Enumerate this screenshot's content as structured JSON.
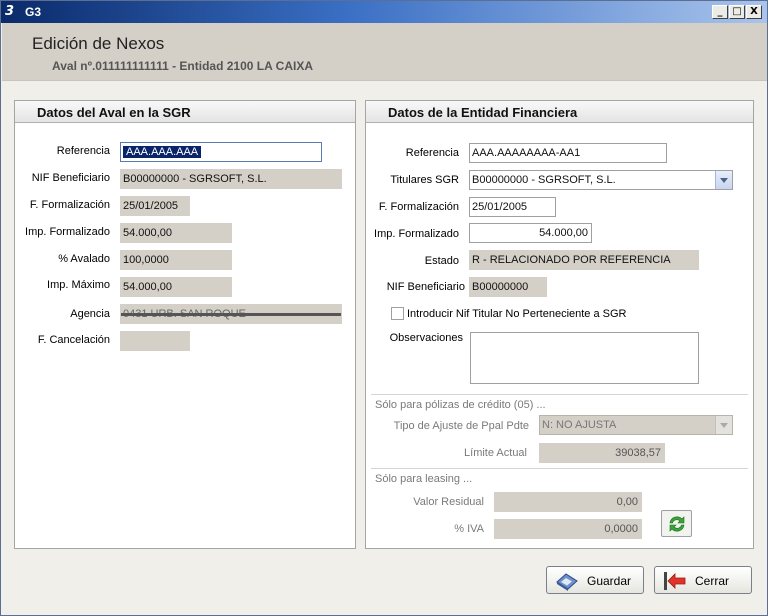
{
  "window": {
    "app_name": "G3",
    "logo": "3",
    "min": "_",
    "max": "□",
    "close": "X"
  },
  "header": {
    "title": "Edición de Nexos",
    "subtitle": "Aval nº.011111111111 - Entidad 2100 LA CAIXA"
  },
  "aval_panel": {
    "title": "Datos del Aval en la SGR",
    "fields": {
      "referencia": {
        "label": "Referencia",
        "value": "AAA.AAA.AAA"
      },
      "nif": {
        "label": "NIF Beneficiario",
        "value": "B00000000 - SGRSOFT, S.L."
      },
      "f_formalizacion": {
        "label": "F. Formalización",
        "value": "25/01/2005"
      },
      "imp_formalizado": {
        "label": "Imp. Formalizado",
        "value": "54.000,00"
      },
      "pct_avalado": {
        "label": "% Avalado",
        "value": "100,0000"
      },
      "imp_maximo": {
        "label": "Imp. Máximo",
        "value": "54.000,00"
      },
      "agencia": {
        "label": "Agencia",
        "value": "0431 URB. SAN ROQUE"
      },
      "f_cancelacion": {
        "label": "F. Cancelación",
        "value": ""
      }
    }
  },
  "entidad_panel": {
    "title": "Datos de la Entidad Financiera",
    "fields": {
      "referencia": {
        "label": "Referencia",
        "value": "AAA.AAAAAAAA-AA1"
      },
      "titulares": {
        "label": "Titulares SGR",
        "value": "B00000000 - SGRSOFT, S.L."
      },
      "f_formalizacion": {
        "label": "F. Formalización",
        "value": "25/01/2005"
      },
      "imp_formalizado": {
        "label": "Imp. Formalizado",
        "value": "54.000,00"
      },
      "estado": {
        "label": "Estado",
        "value": "R - RELACIONADO POR REFERENCIA"
      },
      "nif": {
        "label": "NIF Beneficiario",
        "value": "B00000000"
      },
      "checkbox_label": "Introducir Nif Titular No Perteneciente a SGR",
      "observaciones": {
        "label": "Observaciones",
        "value": ""
      }
    },
    "credito": {
      "section": "Sólo para pólizas de crédito (05) ...",
      "tipo_ajuste": {
        "label": "Tipo de Ajuste de Ppal Pdte",
        "value": "N: NO AJUSTA"
      },
      "limite": {
        "label": "Límite Actual",
        "value": "39038,57"
      }
    },
    "leasing": {
      "section": "Sólo para leasing ...",
      "valor_residual": {
        "label": "Valor Residual",
        "value": "0,00"
      },
      "iva": {
        "label": "% IVA",
        "value": "0,0000"
      }
    }
  },
  "footer": {
    "save_label": "Guardar",
    "cancel_label": "Cerrar"
  }
}
